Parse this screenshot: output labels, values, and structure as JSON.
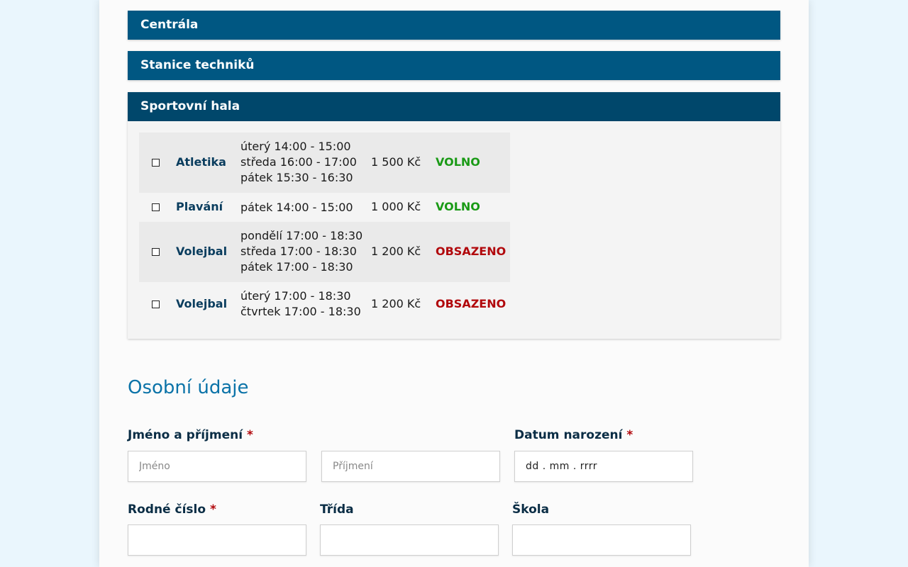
{
  "accordion": {
    "sections": [
      {
        "label": "Centrála"
      },
      {
        "label": "Stanice techniků"
      },
      {
        "label": "Sportovní hala"
      }
    ]
  },
  "activities": [
    {
      "name": "Atletika",
      "times": [
        "úterý 14:00 - 15:00",
        "středa 16:00 - 17:00",
        "pátek 15:30 - 16:30"
      ],
      "price": "1 500 Kč",
      "status": "VOLNO",
      "checked": false
    },
    {
      "name": "Plavání",
      "times": [
        "pátek 14:00 - 15:00"
      ],
      "price": "1 000 Kč",
      "status": "VOLNO",
      "checked": false
    },
    {
      "name": "Volejbal",
      "times": [
        "pondělí 17:00 - 18:30",
        "středa 17:00 - 18:30",
        "pátek 17:00 - 18:30"
      ],
      "price": "1 200 Kč",
      "status": "OBSAZENO",
      "checked": false
    },
    {
      "name": "Volejbal",
      "times": [
        "úterý 17:00 - 18:30",
        "čtvrtek 17:00 - 18:30"
      ],
      "price": "1 200 Kč",
      "status": "OBSAZENO",
      "checked": false
    }
  ],
  "personal": {
    "title": "Osobní údaje",
    "name_label": "Jméno a příjmení",
    "first_placeholder": "Jméno",
    "last_placeholder": "Příjmení",
    "dob_label": "Datum narození",
    "dob_placeholder": "dd . mm . rrrr",
    "birth_number_label": "Rodné číslo",
    "class_label": "Třída",
    "school_label": "Škola",
    "required_mark": "*"
  },
  "colors": {
    "header": "#005782",
    "header_open": "#00476b",
    "free": "#1a9a16",
    "busy": "#b1080c",
    "title": "#0b73a8"
  }
}
